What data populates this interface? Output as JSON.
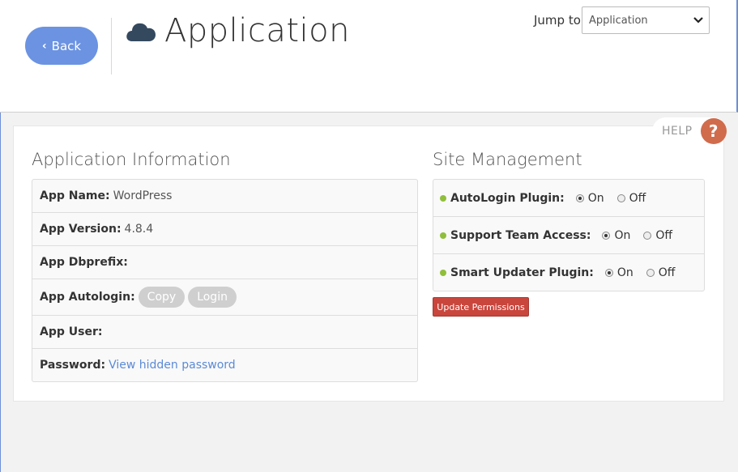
{
  "header": {
    "back_label": "Back",
    "page_title": "Application",
    "jump_label": "Jump to:",
    "jump_selected": "Application"
  },
  "help_label": "HELP",
  "help_symbol": "?",
  "app_info": {
    "title": "Application Information",
    "rows": [
      {
        "label": "App Name:",
        "value": "WordPress"
      },
      {
        "label": "App Version:",
        "value": "4.8.4"
      },
      {
        "label": "App Dbprefix:",
        "value": ""
      },
      {
        "label": "App Autologin:",
        "buttons": [
          "Copy",
          "Login"
        ]
      },
      {
        "label": "App User:",
        "value": ""
      },
      {
        "label": "Password:",
        "link": "View hidden password"
      }
    ]
  },
  "site_management": {
    "title": "Site Management",
    "rows": [
      {
        "label": "AutoLogin Plugin:",
        "on": "On",
        "off": "Off",
        "selected": "On"
      },
      {
        "label": "Support Team Access:",
        "on": "On",
        "off": "Off",
        "selected": "On"
      },
      {
        "label": "Smart Updater Plugin:",
        "on": "On",
        "off": "Off",
        "selected": "On"
      }
    ],
    "update_button": "Update Permissions"
  },
  "colors": {
    "back_button": "#6b93e2",
    "help_circle": "#d06b4c",
    "update_button": "#c9463d",
    "status_dot": "#8fbf3a",
    "link": "#5b8ad6"
  }
}
